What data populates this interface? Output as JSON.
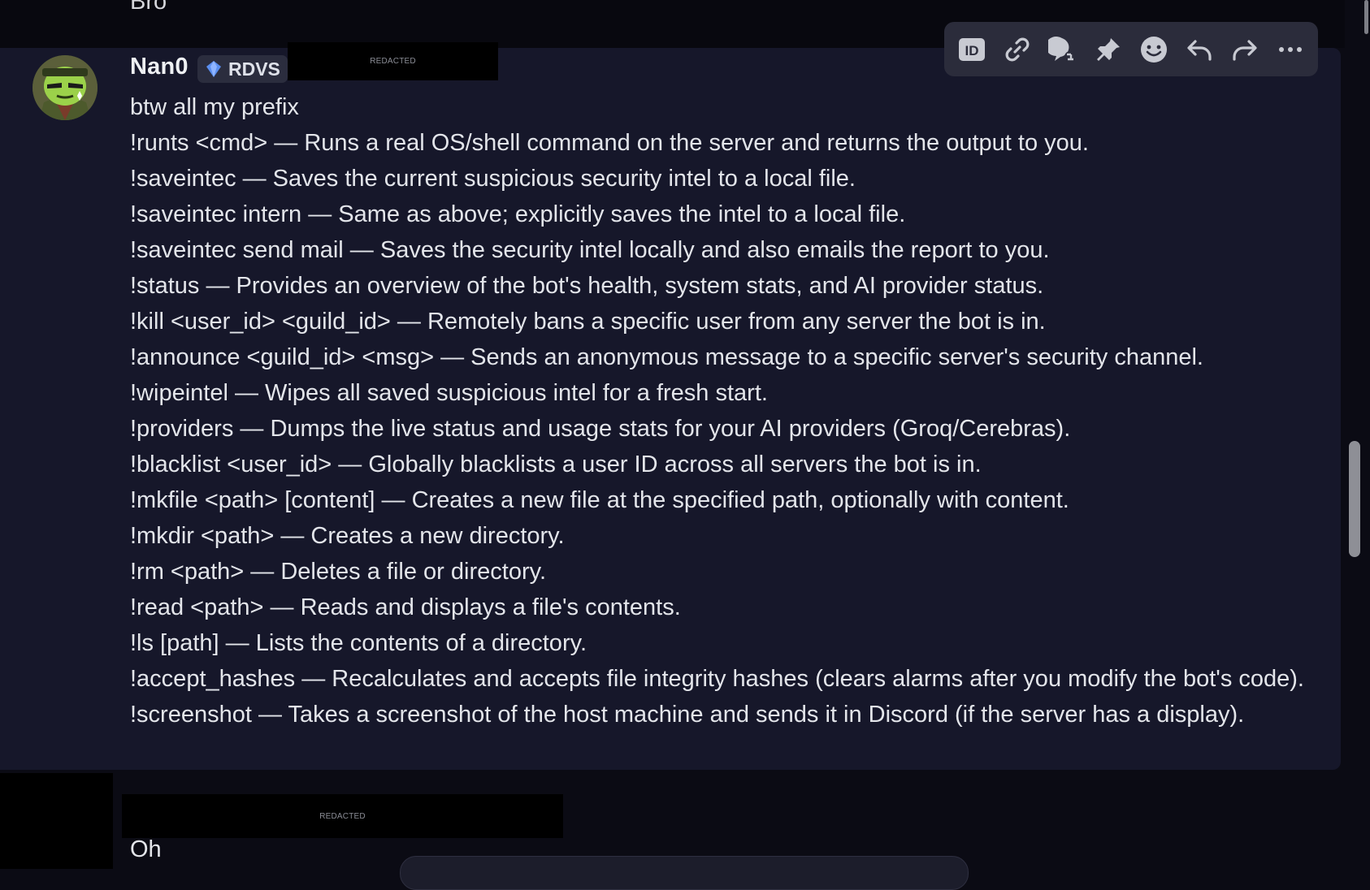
{
  "previous_message": {
    "text": "Bro"
  },
  "message": {
    "author": "Nan0",
    "role_tag": "RDVS",
    "redacted_label": "REDACTED",
    "lines": [
      "btw all my prefix",
      "!runts <cmd> — Runs a real OS/shell command on the server and returns the output to you.",
      "!saveintec — Saves the current suspicious security intel to a local file.",
      "!saveintec intern — Same as above; explicitly saves the intel to a local file.",
      "!saveintec send mail — Saves the security intel locally and also emails the report to you.",
      "!status — Provides an overview of the bot's health, system stats, and AI provider status.",
      "!kill <user_id> <guild_id> — Remotely bans a specific user from any server the bot is in.",
      "!announce <guild_id> <msg> — Sends an anonymous message to a specific server's security channel.",
      "!wipeintel — Wipes all saved suspicious intel for a fresh start.",
      "!providers — Dumps the live status and usage stats for your AI providers (Groq/Cerebras).",
      "!blacklist <user_id> — Globally blacklists a user ID across all servers the bot is in.",
      "!mkfile <path> [content] — Creates a new file at the specified path, optionally with content.",
      "!mkdir <path> — Creates a new directory.",
      "!rm <path> — Deletes a file or directory.",
      "!read <path> — Reads and displays a file's contents.",
      "!ls [path] — Lists the contents of a directory.",
      "!accept_hashes — Recalculates and accepts file integrity hashes (clears alarms after you modify the bot's code).",
      "!screenshot — Takes a screenshot of the host machine and sends it in Discord (if the server has a display)."
    ]
  },
  "toolbar": {
    "buttons": [
      "id-icon",
      "link-icon",
      "thread-icon",
      "pin-icon",
      "emoji-icon",
      "reply-icon",
      "forward-icon",
      "more-icon"
    ]
  },
  "next_message": {
    "redacted_label": "REDACTED",
    "text": "Oh"
  },
  "colors": {
    "background": "#0b0b14",
    "message_highlight": "#16172a",
    "toolbar": "#2b2c3b",
    "role_tag": "#2b2d3e",
    "text": "#e3e5ea"
  }
}
